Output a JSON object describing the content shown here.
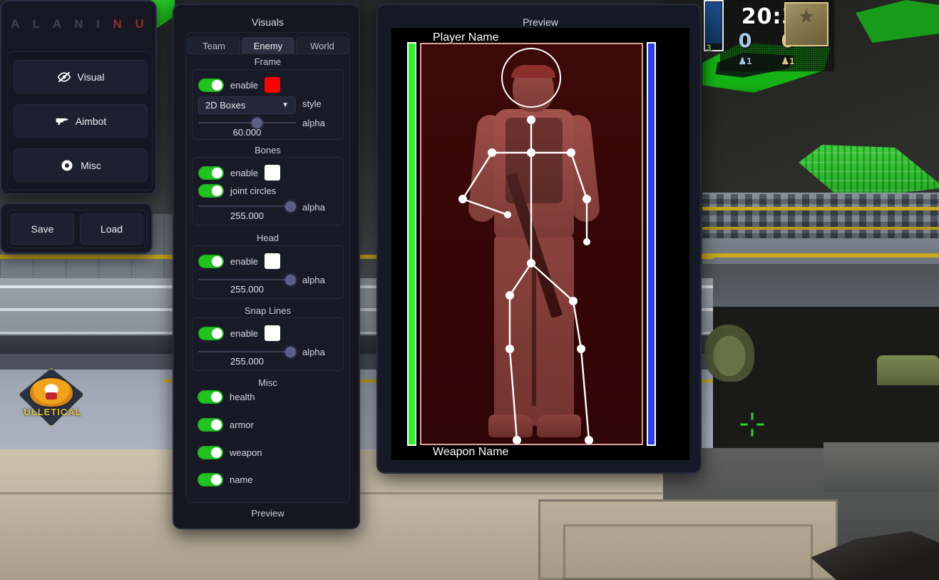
{
  "brand": {
    "part1": "A L A N I",
    "part2": "N U"
  },
  "left_menu": {
    "items": [
      {
        "label": "Visual",
        "icon": "eye-slash-icon"
      },
      {
        "label": "Aimbot",
        "icon": "pistol-icon"
      },
      {
        "label": "Misc",
        "icon": "circle-dot-icon"
      }
    ],
    "save_label": "Save",
    "load_label": "Load"
  },
  "visuals": {
    "title": "Visuals",
    "tabs": [
      {
        "label": "Team",
        "active": false
      },
      {
        "label": "Enemy",
        "active": true
      },
      {
        "label": "World",
        "active": false
      }
    ],
    "frame": {
      "group_label": "Frame",
      "enable_label": "enable",
      "enable_on": true,
      "color": "#FF0000",
      "style_value": "2D Boxes",
      "style_label": "style",
      "alpha_label": "alpha",
      "alpha_value": "60.000",
      "alpha_percent": 60
    },
    "bones": {
      "group_label": "Bones",
      "enable_label": "enable",
      "enable_on": true,
      "color": "#FFFFFF",
      "joint_label": "joint circles",
      "joint_on": true,
      "alpha_label": "alpha",
      "alpha_value": "255.000",
      "alpha_percent": 100
    },
    "head": {
      "group_label": "Head",
      "enable_label": "enable",
      "enable_on": true,
      "color": "#FFFFFF",
      "alpha_label": "alpha",
      "alpha_value": "255.000",
      "alpha_percent": 100
    },
    "snap_lines": {
      "group_label": "Snap Lines",
      "enable_label": "enable",
      "enable_on": true,
      "color": "#FFFFFF",
      "alpha_label": "alpha",
      "alpha_value": "255.000",
      "alpha_percent": 100
    },
    "misc": {
      "group_label": "Misc",
      "toggles": [
        {
          "label": "health",
          "on": true
        },
        {
          "label": "armor",
          "on": true
        },
        {
          "label": "weapon",
          "on": true
        },
        {
          "label": "name",
          "on": true
        }
      ]
    },
    "footer_label": "Preview"
  },
  "preview": {
    "title": "Preview",
    "player_name": "Player Name",
    "weapon_name": "Weapon Name",
    "health_color": "#31EF31",
    "armor_color": "#2B3CEC",
    "health_percent": 100,
    "armor_percent": 100,
    "box_color": "#FFBEBE"
  },
  "hud": {
    "timer": "20:33",
    "score_ct": "0",
    "score_t": "0",
    "alive_ct": "1",
    "alive_t": "1",
    "ammo": "3",
    "rank_star": "★"
  },
  "scene": {
    "wall_logo_text": "ULLETICAL"
  }
}
